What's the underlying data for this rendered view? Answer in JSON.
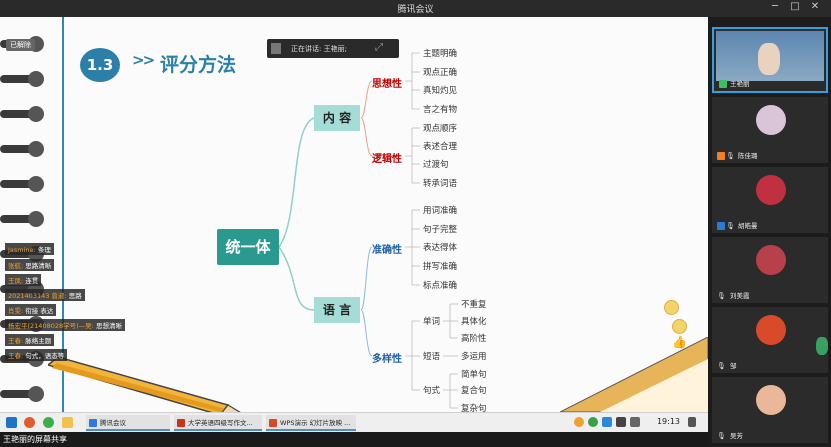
{
  "window": {
    "title": "腾讯会议",
    "controls": [
      "─",
      "□",
      "✕"
    ]
  },
  "slide": {
    "section_number": "1.3",
    "arrows": ">>",
    "heading": "评分方法",
    "speaker_label": "正在讲话: 王艳丽;",
    "mindmap": {
      "root": "统一体",
      "branches": [
        {
          "label": "内 容",
          "children": [
            {
              "label": "思想性",
              "leaves": [
                "主题明确",
                "观点正确",
                "真知灼见",
                "言之有物"
              ]
            },
            {
              "label": "逻辑性",
              "leaves": [
                "观点顺序",
                "表述合理",
                "过渡句",
                "转承词语"
              ]
            }
          ]
        },
        {
          "label": "语 言",
          "children": [
            {
              "label": "准确性",
              "leaves": [
                "用词准确",
                "句子完整",
                "表达得体",
                "拼写准确",
                "标点准确"
              ]
            },
            {
              "label": "多样性",
              "groups": [
                {
                  "label": "单词",
                  "leaves": [
                    "不重复",
                    "具体化",
                    "高阶性"
                  ]
                },
                {
                  "label": "短语",
                  "leaves": [
                    "多运用"
                  ]
                },
                {
                  "label": "句式",
                  "leaves": [
                    "简单句",
                    "复合句",
                    "复杂句"
                  ]
                }
              ]
            }
          ]
        }
      ]
    },
    "chat_messages": [
      {
        "name": "Jasmine:",
        "text": "条理"
      },
      {
        "name": "张航:",
        "text": "思路清晰"
      },
      {
        "name": "王凤:",
        "text": "连贯"
      },
      {
        "name": "2021403143 曾淑:",
        "text": "思路"
      },
      {
        "name": "肖雯:",
        "text": "衔接 表达"
      },
      {
        "name": "杨宏平(21408028学号)—吴:",
        "text": "思想清晰"
      },
      {
        "name": "王春:",
        "text": "脉络主题"
      },
      {
        "name": "王春:",
        "text": "句式，语态等"
      }
    ],
    "top_left_label": "已解除"
  },
  "taskbar": {
    "apps": [
      {
        "label": "腾讯会议",
        "color": "#2f7ad8"
      },
      {
        "label": "大学英语四级写作文...",
        "color": "#c8341e"
      },
      {
        "label": "WPS演示 幻灯片放映 ...",
        "color": "#d6482a"
      }
    ],
    "time": "19:13"
  },
  "share_label": "王艳丽的屏幕共享",
  "participants": [
    {
      "name": "王艳丽",
      "avatar_color": "#7ba5c8",
      "active": true
    },
    {
      "name": "陈佳璐",
      "avatar_color": "#d9c4d8",
      "active": false
    },
    {
      "name": "胡皓曼",
      "avatar_color": "#c03040",
      "active": false
    },
    {
      "name": "刘美霞",
      "avatar_color": "#b8404a",
      "active": false
    },
    {
      "name": "邹",
      "avatar_color": "#d84a2a",
      "active": false
    },
    {
      "name": "吴芳",
      "avatar_color": "#e8b898",
      "active": false
    }
  ],
  "colors": {
    "accent": "#2c7fa8",
    "root": "#2a9a8e",
    "branch": "#a6dcd6",
    "red_label": "#c00000",
    "blue_label": "#1f5fa8"
  }
}
